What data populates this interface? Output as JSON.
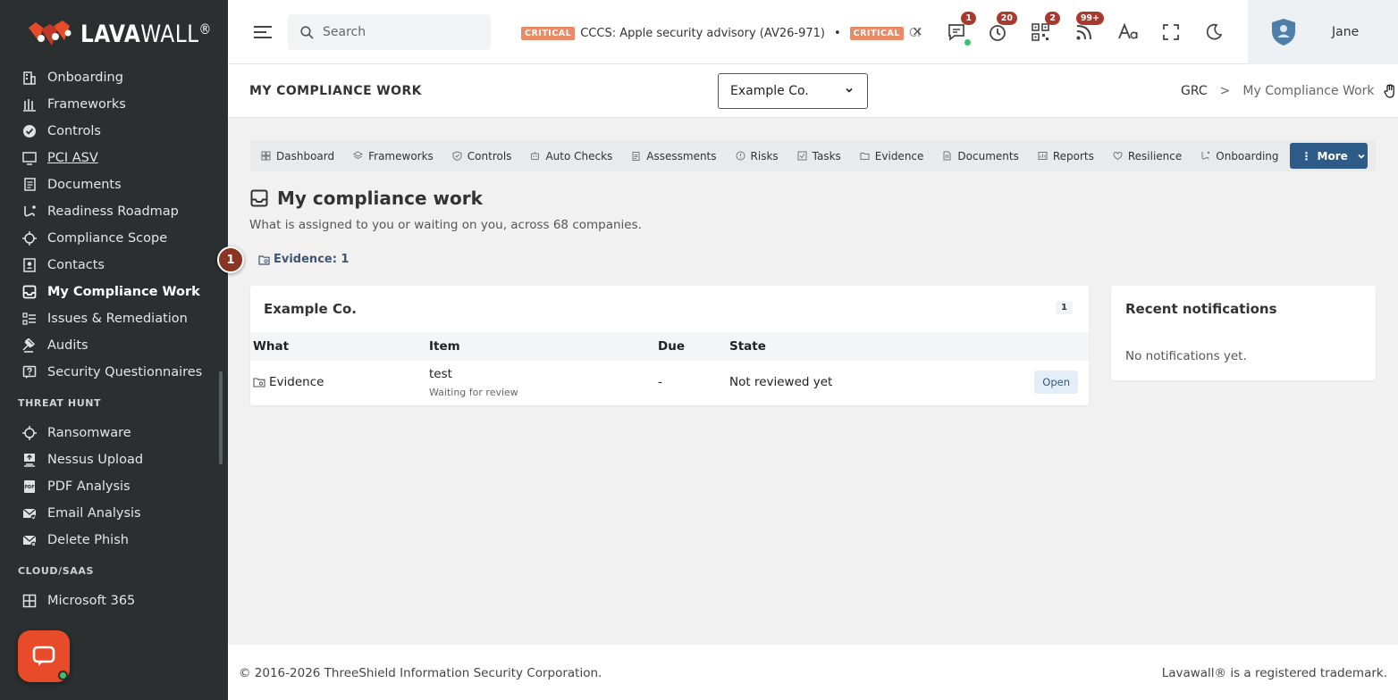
{
  "brand": {
    "name_bold": "LAVA",
    "name_light": "WALL",
    "registered": "®"
  },
  "sidebar": {
    "items": [
      {
        "label": "Onboarding",
        "icon": "building-icon"
      },
      {
        "label": "Frameworks",
        "icon": "columns-icon"
      },
      {
        "label": "Controls",
        "icon": "badge-check-icon"
      },
      {
        "label": "PCI ASV",
        "icon": "monitor-icon"
      },
      {
        "label": "Documents",
        "icon": "documents-icon"
      },
      {
        "label": "Readiness Roadmap",
        "icon": "route-icon"
      },
      {
        "label": "Compliance Scope",
        "icon": "crosshair-icon"
      },
      {
        "label": "Contacts",
        "icon": "contact-card-icon"
      },
      {
        "label": "My Compliance Work",
        "icon": "inbox-icon"
      },
      {
        "label": "Issues & Remediation",
        "icon": "list-icon"
      },
      {
        "label": "Audits",
        "icon": "gavel-icon"
      },
      {
        "label": "Security Questionnaires",
        "icon": "question-icon"
      }
    ],
    "section_threat": "THREAT HUNT",
    "threat_items": [
      {
        "label": "Ransomware",
        "icon": "crosshair-icon"
      },
      {
        "label": "Nessus Upload",
        "icon": "upload-icon"
      },
      {
        "label": "PDF Analysis",
        "icon": "pdf-icon"
      },
      {
        "label": "Email Analysis",
        "icon": "mail-check-icon"
      },
      {
        "label": "Delete Phish",
        "icon": "mail-x-icon"
      }
    ],
    "section_cloud": "CLOUD/SAAS",
    "cloud_items": [
      {
        "label": "Microsoft 365",
        "icon": "windows-icon"
      }
    ]
  },
  "topbar": {
    "search_placeholder": "Search",
    "ticker": {
      "badge1": "CRITICAL",
      "text1": "CCCS: Apple security advisory (AV26-971)",
      "dot": "•",
      "badge2": "CRITICAL",
      "text2": "CI",
      "close": "×"
    },
    "badges": {
      "messages": "1",
      "timer": "20",
      "qr": "2",
      "feeds": "99+"
    },
    "user_name": "Jane"
  },
  "pagehead": {
    "title": "MY COMPLIANCE WORK",
    "company": "Example Co.",
    "breadcrumb_root": "GRC",
    "breadcrumb_sep": ">",
    "breadcrumb_current": "My Compliance Work"
  },
  "tabs": [
    "Dashboard",
    "Frameworks",
    "Controls",
    "Auto Checks",
    "Assessments",
    "Risks",
    "Tasks",
    "Evidence",
    "Documents",
    "Reports",
    "Resilience",
    "Onboarding"
  ],
  "more_label": "More",
  "main": {
    "heading": "My compliance work",
    "subtitle": "What is assigned to you or waiting on you, across 68 companies.",
    "step": "1",
    "filter_label": "Evidence: 1"
  },
  "card": {
    "title": "Example Co.",
    "count": "1",
    "columns": [
      "What",
      "Item",
      "Due",
      "State"
    ],
    "row": {
      "what": "Evidence",
      "item": "test",
      "item_sub": "Waiting for review",
      "due": "-",
      "state": "Not reviewed yet",
      "action": "Open"
    }
  },
  "notifications": {
    "title": "Recent notifications",
    "empty": "No notifications yet."
  },
  "footer": {
    "left": "© 2016-2026 ThreeShield Information Security Corporation.",
    "right": "Lavawall® is a registered trademark."
  },
  "colors": {
    "sidebar_bg": "#2b2f30",
    "accent": "#2e5a87",
    "brand_red": "#e84b2a",
    "critical": "#e98a67",
    "badge": "#a83a2d"
  }
}
